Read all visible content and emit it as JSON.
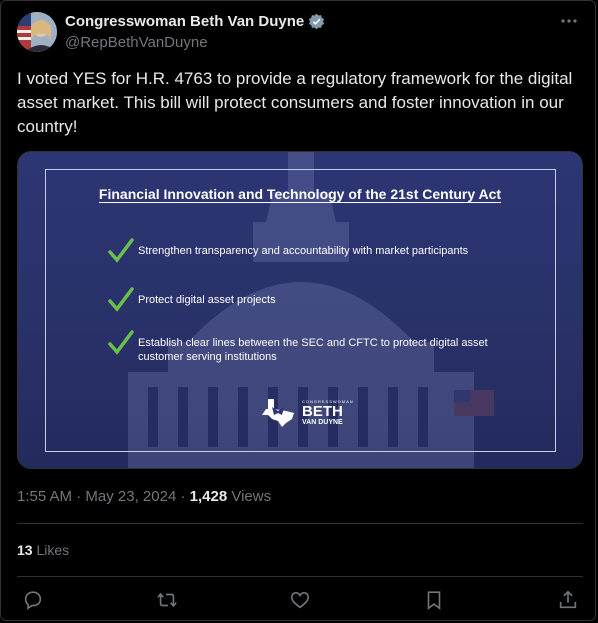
{
  "author": {
    "display_name": "Congresswoman Beth Van Duyne",
    "handle": "@RepBethVanDuyne",
    "verified_icon": "verified-badge-icon"
  },
  "tweet": {
    "text": "I voted YES for H.R. 4763 to provide a regulatory framework for the digital asset market. This bill will protect consumers and foster innovation in our country!"
  },
  "media": {
    "title": "Financial Innovation and Technology of the 21st Century Act",
    "items": [
      {
        "line1": "Strengthen transparency and accountability with market participants",
        "line2": ""
      },
      {
        "line1": "Protect digital asset projects",
        "line2": ""
      },
      {
        "line1": "Establish clear lines between the SEC and CFTC to protect digital asset",
        "line2": "customer serving institutions"
      }
    ],
    "logo": {
      "small": "CONGRESSWOMAN",
      "big": "BETH",
      "mid": "VAN DUYNE"
    },
    "colors": {
      "background": "#2d3674",
      "check": "#6cc04a"
    }
  },
  "meta": {
    "time": "1:55 AM",
    "sep1": " · ",
    "date": "May 23, 2024",
    "sep2": " · ",
    "views_count": "1,428",
    "views_label": " Views"
  },
  "likes": {
    "count": "13",
    "label": " Likes"
  },
  "actions": [
    "reply-icon",
    "retweet-icon",
    "like-icon",
    "bookmark-icon",
    "share-icon"
  ],
  "colors": {
    "background": "#000000",
    "text": "#e7e9ea",
    "muted": "#71767b",
    "border": "#2f3336",
    "verified": "#829aab"
  }
}
